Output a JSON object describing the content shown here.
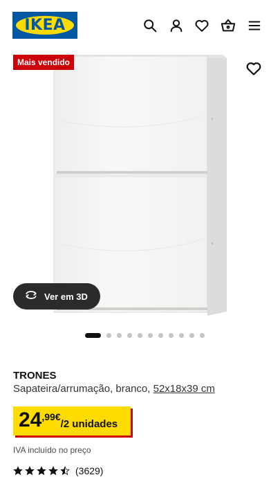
{
  "header": {
    "logo_text": "IKEA",
    "icons": [
      "search-icon",
      "user-icon",
      "heart-icon",
      "basket-icon",
      "menu-icon"
    ]
  },
  "gallery": {
    "badge": "Mais vendido",
    "view3d_label": "Ver em 3D",
    "image_count": 11,
    "active_index": 0
  },
  "product": {
    "name": "TRONES",
    "description": "Sapateira/arrumação, branco, ",
    "size": "52x18x39 cm",
    "price_integer": "24",
    "price_decimal": ",99€",
    "price_unit": "/2 unidades",
    "vat_note": "IVA incluído no preço",
    "rating_stars": 4.5,
    "rating_count": "(3629)"
  },
  "colors": {
    "brand_blue": "#0058a3",
    "brand_yellow": "#ffdb00",
    "badge_red": "#cc0008"
  }
}
